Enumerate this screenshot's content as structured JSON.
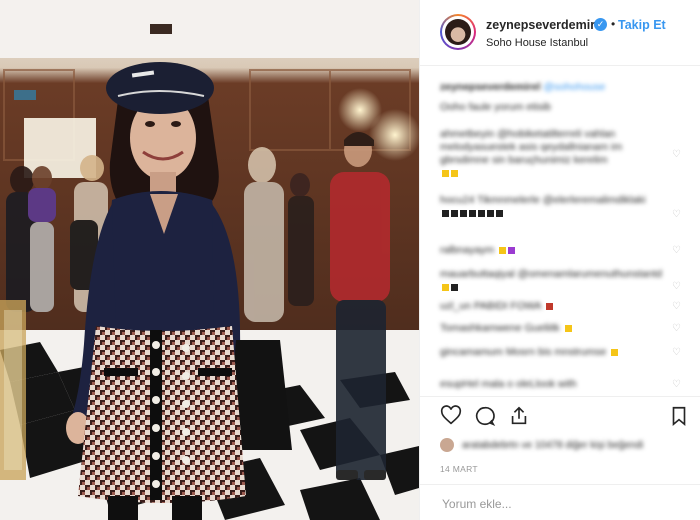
{
  "header": {
    "username": "zeynepseverdemirel",
    "verified_icon": "verified-badge-icon",
    "separator": "•",
    "follow_label": "Takip Et",
    "location": "Soho House Istanbul"
  },
  "caption": {
    "username": "zeynepseverdemirel",
    "tag": "@sohohouse",
    "line2": "Ooho faule yorum etisib"
  },
  "comments": [
    {
      "text": "ahmetbeyin @hobiketatilterreli vahlan melodyasuestek asis qeydallnianam im gbrsdimne sin baruçhunimiz kerelim"
    },
    {
      "text": "hocu24 Tikmnmelerle @elerleremalimdiklaki"
    },
    {
      "text": "ralbnayaym"
    },
    {
      "text": "mauarbuttaqiyal @omenamlarumenuthunstantd"
    },
    {
      "text": "uzl_un PABIDI FOWA"
    },
    {
      "text": "Tomashkamwene Gueliitk"
    },
    {
      "text": "gincamamum Mosrn bis mnstrumse"
    },
    {
      "text": "esupHel mala o oleLlook with"
    }
  ],
  "icons": {
    "like": "heart-icon",
    "comment": "comment-icon",
    "share": "share-icon",
    "save": "bookmark-icon"
  },
  "likes_text": "aratabdebrtn ve 10478 diğer kişi beğendi",
  "date": "14 MART",
  "comment_input": {
    "placeholder": "Yorum ekle..."
  },
  "colors": {
    "accent": "#3897f0",
    "text": "#262626",
    "muted": "#999999",
    "divider": "#efefef"
  }
}
